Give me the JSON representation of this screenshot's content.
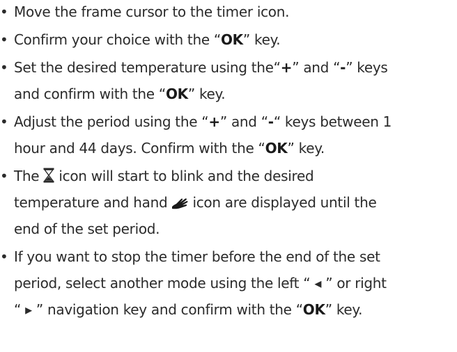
{
  "bullet": "•",
  "steps": [
    {
      "lines": [
        {
          "segments": [
            "Move the frame cursor to the timer icon."
          ]
        }
      ]
    },
    {
      "lines": [
        {
          "segments": [
            "Confirm your choice with the “",
            "OK",
            "” key."
          ]
        }
      ]
    },
    {
      "lines": [
        {
          "segments": [
            "Set the desired temperature using the“",
            "+",
            "” and “",
            "-",
            "” keys"
          ]
        },
        {
          "segments": [
            "and confirm with the “",
            "OK",
            "” key."
          ]
        }
      ]
    },
    {
      "lines": [
        {
          "segments": [
            "Adjust the period using the “",
            "+",
            "” and “",
            "-",
            "“ keys between 1"
          ]
        },
        {
          "segments": [
            "hour and 44 days. Confirm with the “",
            "OK",
            "” key."
          ]
        }
      ]
    },
    {
      "lines": [
        {
          "segments": [
            "The ",
            " icon will start to blink and the desired"
          ]
        },
        {
          "segments": [
            "temperature and hand ",
            " icon  are displayed until the"
          ]
        },
        {
          "segments": [
            "end of the set period."
          ]
        }
      ]
    },
    {
      "lines": [
        {
          "segments": [
            "If you want to stop the timer before the end of the set"
          ]
        },
        {
          "segments": [
            "period, select another mode using the  left “ ",
            "◂",
            " ” or right"
          ]
        },
        {
          "segments": [
            "“ ",
            "▸",
            " ” navigation key and confirm with the “",
            "OK",
            "” key."
          ]
        }
      ]
    }
  ],
  "icons": {
    "timer": "hourglass-icon",
    "hand": "hand-icon"
  }
}
